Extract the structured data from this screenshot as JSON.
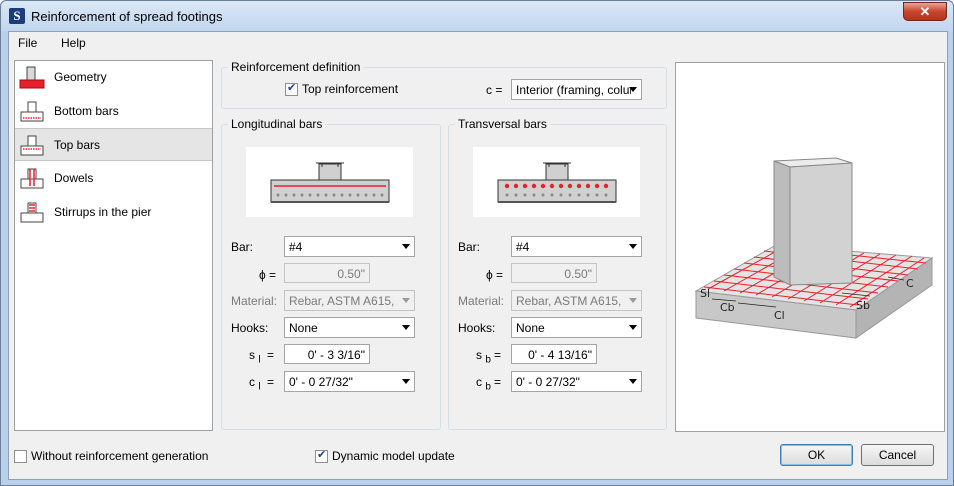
{
  "window": {
    "title": "Reinforcement of spread footings",
    "app_icon": "S"
  },
  "menu": {
    "items": [
      "File",
      "Help"
    ]
  },
  "nav": {
    "items": [
      {
        "label": "Geometry",
        "icon": "geometry-icon"
      },
      {
        "label": "Bottom bars",
        "icon": "bottom-bars-icon"
      },
      {
        "label": "Top bars",
        "icon": "top-bars-icon",
        "selected": true
      },
      {
        "label": "Dowels",
        "icon": "dowels-icon"
      },
      {
        "label": "Stirrups in the pier",
        "icon": "stirrups-icon"
      }
    ]
  },
  "definition": {
    "title": "Reinforcement definition",
    "top_reinforcement_label": "Top reinforcement",
    "top_reinforcement_checked": true,
    "c_label": "c =",
    "c_value": "Interior (framing, columr"
  },
  "longitudinal": {
    "title": "Longitudinal bars",
    "bar_label": "Bar:",
    "bar_value": "#4",
    "phi_label": "ϕ =",
    "phi_value": "0.50\"",
    "material_label": "Material:",
    "material_value": "Rebar, ASTM A615,",
    "hooks_label": "Hooks:",
    "hooks_value": "None",
    "s_label": "s",
    "s_sub": "l",
    "s_eq": "=",
    "s_value": "0' - 3 3/16\"",
    "c_label": "c",
    "c_sub": "l",
    "c_eq": "=",
    "c_value": "0' - 0 27/32\""
  },
  "transversal": {
    "title": "Transversal bars",
    "bar_label": "Bar:",
    "bar_value": "#4",
    "phi_label": "ϕ =",
    "phi_value": "0.50\"",
    "material_label": "Material:",
    "material_value": "Rebar, ASTM A615,",
    "hooks_label": "Hooks:",
    "hooks_value": "None",
    "s_label": "s",
    "s_sub": "b",
    "s_eq": "=",
    "s_value": "0' - 4 13/16\"",
    "c_label": "c",
    "c_sub": "b",
    "c_eq": "=",
    "c_value": "0' - 0 27/32\""
  },
  "preview_labels": {
    "sl": "Sl",
    "cb": "Cb",
    "cl": "Cl",
    "sb": "Sb",
    "c": "C"
  },
  "footer": {
    "without_label": "Without reinforcement generation",
    "without_checked": false,
    "dynamic_label": "Dynamic model update",
    "dynamic_checked": true,
    "ok_label": "OK",
    "cancel_label": "Cancel"
  },
  "colors": {
    "rebar": "#e8202a",
    "concrete": "#c8c8c8",
    "accent": "#3c7fb1"
  }
}
